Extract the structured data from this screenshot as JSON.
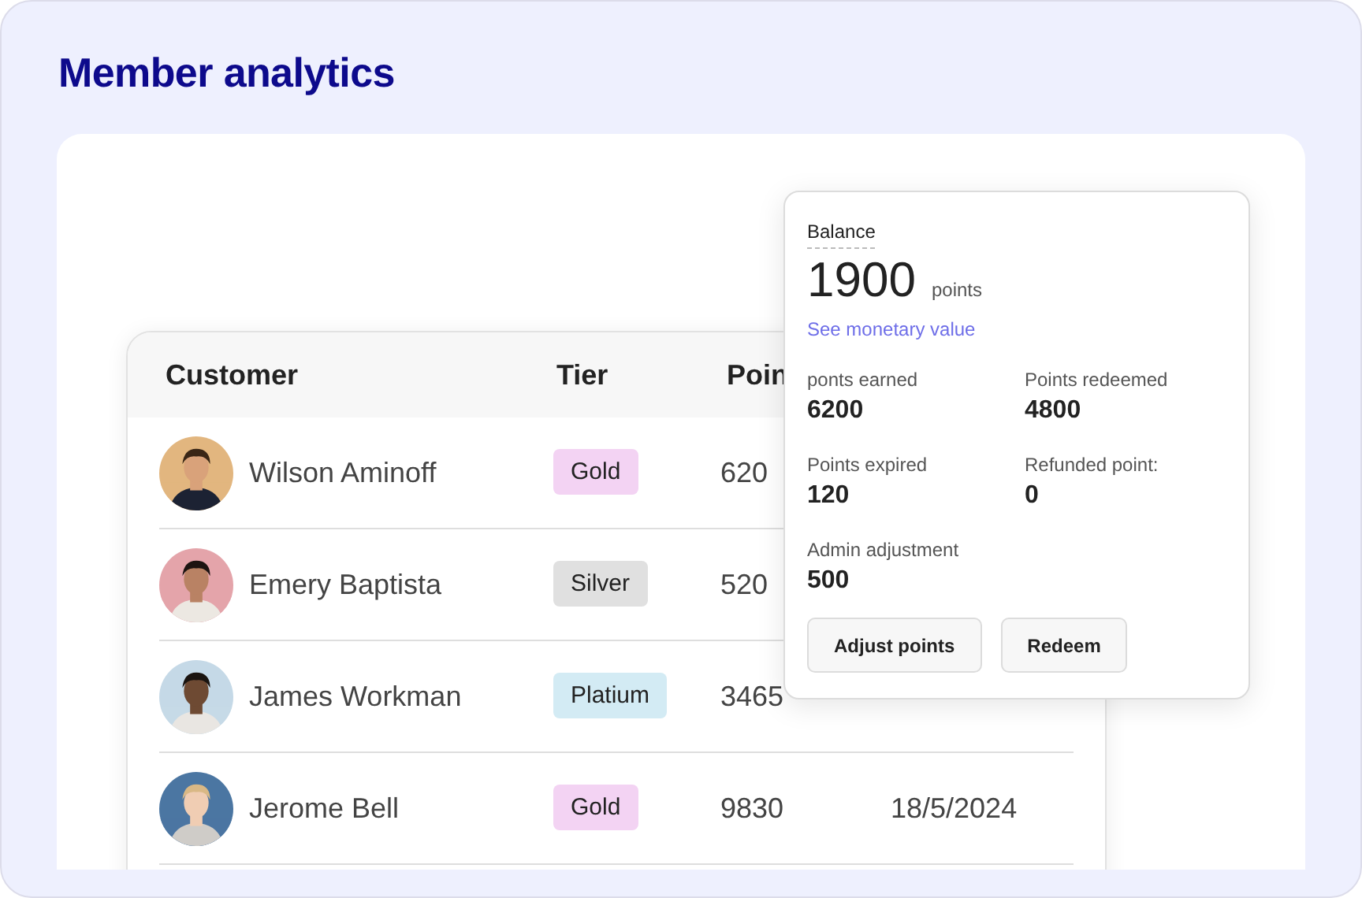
{
  "title": "Member analytics",
  "table": {
    "columns": [
      "Customer",
      "Tier",
      "Poin"
    ],
    "rows": [
      {
        "name": "Wilson Aminoff",
        "tier": {
          "label": "Gold",
          "color": "#f3d3f3"
        },
        "points": "620"
      },
      {
        "name": "Emery Baptista",
        "tier": {
          "label": "Silver",
          "color": "#e0e0e0"
        },
        "points": "520"
      },
      {
        "name": "James Workman",
        "tier": {
          "label": "Platium",
          "color": "#d3ebf4"
        },
        "points": "3465"
      },
      {
        "name": "Jerome Bell",
        "tier": {
          "label": "Gold",
          "color": "#f3d3f3"
        },
        "points": "9830",
        "date": "18/5/2024"
      }
    ]
  },
  "balance_popover": {
    "label": "Balance",
    "value": "1900",
    "unit": "points",
    "link": "See monetary value",
    "stats": [
      {
        "label": "ponts earned",
        "value": "6200"
      },
      {
        "label": "Points redeemed",
        "value": "4800"
      },
      {
        "label": "Points expired",
        "value": "120"
      },
      {
        "label": "Refunded point:",
        "value": "0"
      },
      {
        "label": "Admin adjustment",
        "value": "500"
      }
    ],
    "buttons": [
      "Adjust points",
      "Redeem"
    ]
  }
}
